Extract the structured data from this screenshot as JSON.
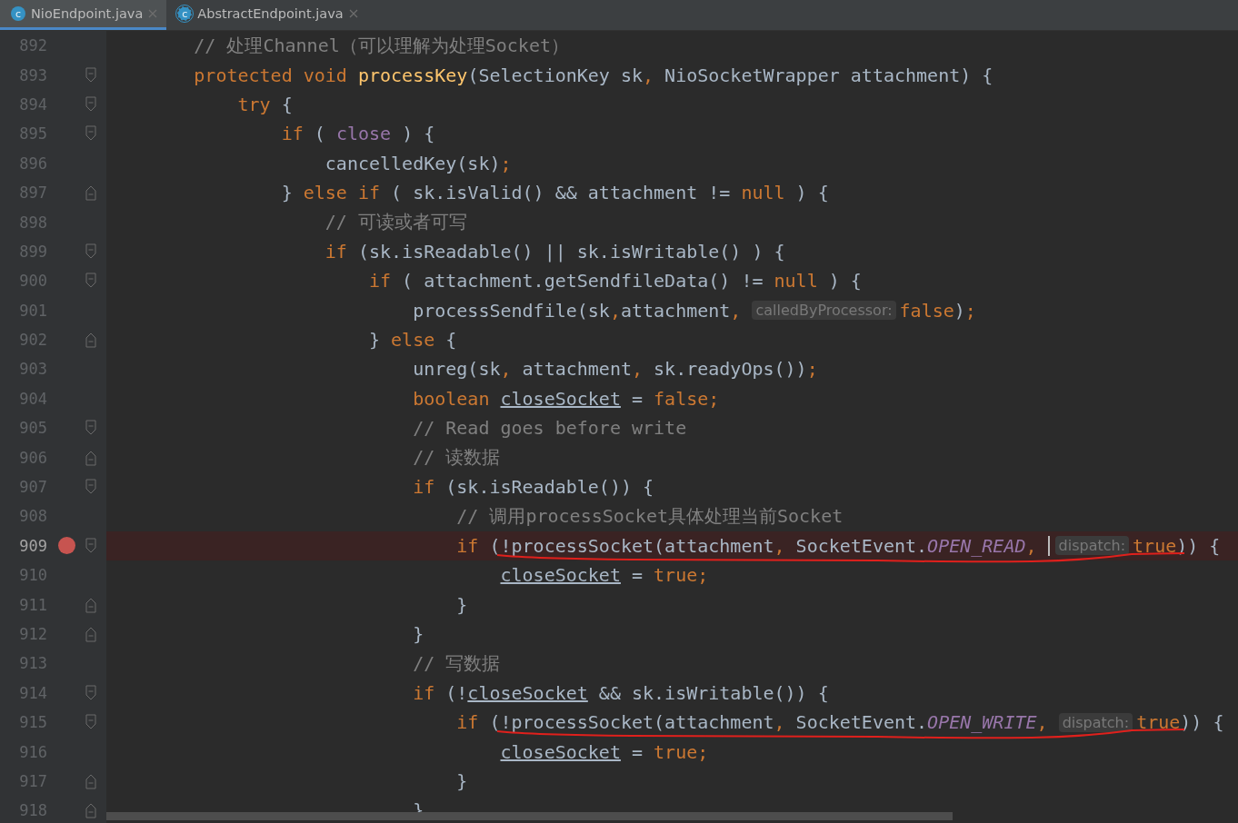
{
  "tabs": [
    {
      "label": "NioEndpoint.java",
      "icon_letter": "c",
      "kind": "class",
      "selected": true
    },
    {
      "label": "AbstractEndpoint.java",
      "icon_letter": "c",
      "kind": "abstract",
      "selected": false
    }
  ],
  "lines": [
    {
      "number": "892",
      "fold_start": false,
      "fold_end": false,
      "tokens": [
        {
          "kind": "cm",
          "text": "        // 处理Channel（可以理解为处理Socket）"
        }
      ]
    },
    {
      "number": "893",
      "fold_start": true,
      "fold_end": false,
      "tokens": [
        {
          "kind": "kw",
          "text": "        protected void "
        },
        {
          "kind": "fn",
          "text": "processKey"
        },
        {
          "kind": "id",
          "text": "(SelectionKey sk"
        },
        {
          "kind": "kw",
          "text": ","
        },
        {
          "kind": "id",
          "text": " NioSocketWrapper attachment) {"
        }
      ]
    },
    {
      "number": "894",
      "fold_start": true,
      "fold_end": false,
      "tokens": [
        {
          "kind": "kw",
          "text": "            try"
        },
        {
          "kind": "id",
          "text": " {"
        }
      ]
    },
    {
      "number": "895",
      "fold_start": true,
      "fold_end": false,
      "tokens": [
        {
          "kind": "kw",
          "text": "                if"
        },
        {
          "kind": "id",
          "text": " ( "
        },
        {
          "kind": "field",
          "text": "close"
        },
        {
          "kind": "id",
          "text": " ) {"
        }
      ]
    },
    {
      "number": "896",
      "fold_start": false,
      "fold_end": false,
      "tokens": [
        {
          "kind": "id",
          "text": "                    cancelledKey(sk)"
        },
        {
          "kind": "kw",
          "text": ";"
        }
      ]
    },
    {
      "number": "897",
      "fold_start": false,
      "fold_end": true,
      "tokens": [
        {
          "kind": "id",
          "text": "                } "
        },
        {
          "kind": "kw",
          "text": "else if"
        },
        {
          "kind": "id",
          "text": " ( sk.isValid() && attachment != "
        },
        {
          "kind": "kw",
          "text": "null"
        },
        {
          "kind": "id",
          "text": " ) {"
        }
      ]
    },
    {
      "number": "898",
      "fold_start": false,
      "fold_end": false,
      "tokens": [
        {
          "kind": "cm",
          "text": "                    // 可读或者可写"
        }
      ]
    },
    {
      "number": "899",
      "fold_start": true,
      "fold_end": false,
      "tokens": [
        {
          "kind": "kw",
          "text": "                    if"
        },
        {
          "kind": "id",
          "text": " (sk.isReadable() || sk.isWritable() ) {"
        }
      ]
    },
    {
      "number": "900",
      "fold_start": true,
      "fold_end": false,
      "tokens": [
        {
          "kind": "kw",
          "text": "                        if"
        },
        {
          "kind": "id",
          "text": " ( attachment.getSendfileData() != "
        },
        {
          "kind": "kw",
          "text": "null"
        },
        {
          "kind": "id",
          "text": " ) {"
        }
      ]
    },
    {
      "number": "901",
      "fold_start": false,
      "fold_end": false,
      "tokens": [
        {
          "kind": "id",
          "text": "                            processSendfile(sk"
        },
        {
          "kind": "kw",
          "text": ","
        },
        {
          "kind": "id",
          "text": "attachment"
        },
        {
          "kind": "kw",
          "text": ", "
        },
        {
          "kind": "hint",
          "text": "calledByProcessor:"
        },
        {
          "kind": "kw",
          "text": "false"
        },
        {
          "kind": "id",
          "text": ")"
        },
        {
          "kind": "kw",
          "text": ";"
        }
      ]
    },
    {
      "number": "902",
      "fold_start": false,
      "fold_end": true,
      "tokens": [
        {
          "kind": "id",
          "text": "                        } "
        },
        {
          "kind": "kw",
          "text": "else"
        },
        {
          "kind": "id",
          "text": " {"
        }
      ]
    },
    {
      "number": "903",
      "fold_start": false,
      "fold_end": false,
      "tokens": [
        {
          "kind": "id",
          "text": "                            unreg(sk"
        },
        {
          "kind": "kw",
          "text": ","
        },
        {
          "kind": "id",
          "text": " attachment"
        },
        {
          "kind": "kw",
          "text": ","
        },
        {
          "kind": "id",
          "text": " sk.readyOps())"
        },
        {
          "kind": "kw",
          "text": ";"
        }
      ]
    },
    {
      "number": "904",
      "fold_start": false,
      "fold_end": false,
      "tokens": [
        {
          "kind": "kw",
          "text": "                            boolean "
        },
        {
          "kind": "var",
          "text": "closeSocket"
        },
        {
          "kind": "id",
          "text": " = "
        },
        {
          "kind": "kw",
          "text": "false;"
        }
      ]
    },
    {
      "number": "905",
      "fold_start": true,
      "fold_end": false,
      "tokens": [
        {
          "kind": "cm",
          "text": "                            // Read goes before write"
        }
      ]
    },
    {
      "number": "906",
      "fold_start": false,
      "fold_end": true,
      "tokens": [
        {
          "kind": "cm",
          "text": "                            // 读数据"
        }
      ]
    },
    {
      "number": "907",
      "fold_start": true,
      "fold_end": false,
      "tokens": [
        {
          "kind": "kw",
          "text": "                            if"
        },
        {
          "kind": "id",
          "text": " (sk.isReadable()) {"
        }
      ]
    },
    {
      "number": "908",
      "fold_start": false,
      "fold_end": false,
      "tokens": [
        {
          "kind": "cm",
          "text": "                                // 调用processSocket具体处理当前Socket"
        }
      ]
    },
    {
      "number": "909",
      "fold_start": true,
      "fold_end": false,
      "breakpoint": true,
      "annotated": true,
      "tokens": [
        {
          "kind": "kw",
          "text": "                                if"
        },
        {
          "kind": "id",
          "text": " (!processSocket(attachment"
        },
        {
          "kind": "kw",
          "text": ","
        },
        {
          "kind": "id",
          "text": " SocketEvent."
        },
        {
          "kind": "const",
          "text": "OPEN_READ"
        },
        {
          "kind": "kw",
          "text": ", "
        },
        {
          "kind": "caret"
        },
        {
          "kind": "hint",
          "text": "dispatch:"
        },
        {
          "kind": "kw",
          "text": "true"
        },
        {
          "kind": "id",
          "text": ")) {"
        }
      ]
    },
    {
      "number": "910",
      "fold_start": false,
      "fold_end": false,
      "tokens": [
        {
          "kind": "var",
          "text": "                                    closeSocket"
        },
        {
          "kind": "id",
          "text": " = "
        },
        {
          "kind": "kw",
          "text": "true;"
        }
      ]
    },
    {
      "number": "911",
      "fold_start": false,
      "fold_end": true,
      "tokens": [
        {
          "kind": "id",
          "text": "                                }"
        }
      ]
    },
    {
      "number": "912",
      "fold_start": false,
      "fold_end": true,
      "tokens": [
        {
          "kind": "id",
          "text": "                            }"
        }
      ]
    },
    {
      "number": "913",
      "fold_start": false,
      "fold_end": false,
      "tokens": [
        {
          "kind": "cm",
          "text": "                            // 写数据"
        }
      ]
    },
    {
      "number": "914",
      "fold_start": true,
      "fold_end": false,
      "tokens": [
        {
          "kind": "kw",
          "text": "                            if"
        },
        {
          "kind": "id",
          "text": " (!"
        },
        {
          "kind": "var",
          "text": "closeSocket"
        },
        {
          "kind": "id",
          "text": " && sk.isWritable()) {"
        }
      ]
    },
    {
      "number": "915",
      "fold_start": true,
      "fold_end": false,
      "annotated": true,
      "tokens": [
        {
          "kind": "kw",
          "text": "                                if"
        },
        {
          "kind": "id",
          "text": " (!processSocket(attachment"
        },
        {
          "kind": "kw",
          "text": ","
        },
        {
          "kind": "id",
          "text": " SocketEvent."
        },
        {
          "kind": "const",
          "text": "OPEN_WRITE"
        },
        {
          "kind": "kw",
          "text": ", "
        },
        {
          "kind": "hint",
          "text": "dispatch:"
        },
        {
          "kind": "kw",
          "text": "true"
        },
        {
          "kind": "id",
          "text": ")) {"
        }
      ]
    },
    {
      "number": "916",
      "fold_start": false,
      "fold_end": false,
      "tokens": [
        {
          "kind": "var",
          "text": "                                    closeSocket"
        },
        {
          "kind": "id",
          "text": " = "
        },
        {
          "kind": "kw",
          "text": "true;"
        }
      ]
    },
    {
      "number": "917",
      "fold_start": false,
      "fold_end": true,
      "tokens": [
        {
          "kind": "id",
          "text": "                                }"
        }
      ]
    },
    {
      "number": "918",
      "fold_start": false,
      "fold_end": true,
      "tokens": [
        {
          "kind": "id",
          "text": "                            }"
        }
      ]
    }
  ]
}
